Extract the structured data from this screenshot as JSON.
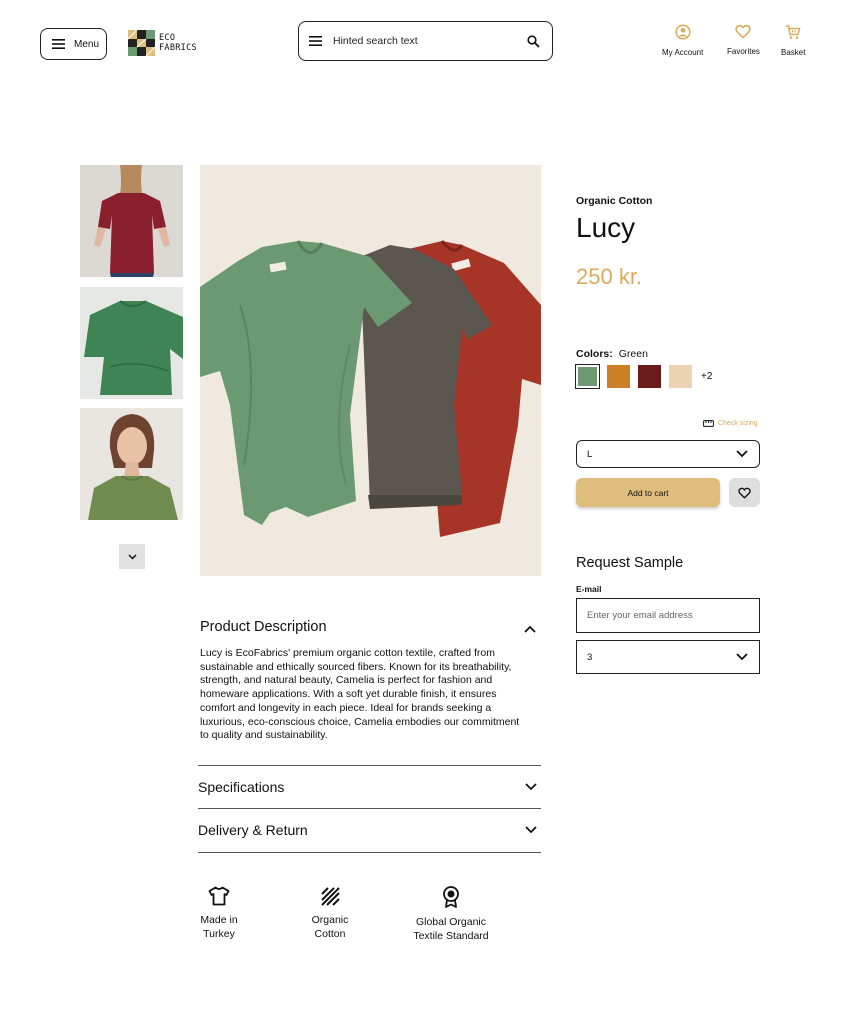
{
  "header": {
    "menu_label": "Menu",
    "logo_line1": "ECO",
    "logo_line2": "FABRICS",
    "search_placeholder": "Hinted search text",
    "account_label": "My Account",
    "favorites_label": "Favorites",
    "basket_label": "Basket"
  },
  "product": {
    "category": "Organic Cotton",
    "name": "Lucy",
    "price": "250 kr.",
    "colors_label": "Colors:",
    "selected_color": "Green",
    "swatches": [
      "#6b9a72",
      "#cc7f26",
      "#6b1c1a",
      "#ead2b2"
    ],
    "more_colors": "+2",
    "check_sizing": "Check sizing",
    "size": "L",
    "add_to_cart": "Add to cart"
  },
  "sample": {
    "title": "Request Sample",
    "email_label": "E-mail",
    "email_placeholder": "Enter your email address",
    "quantity": "3"
  },
  "description": {
    "title": "Product Description",
    "body": "Lucy is EcoFabrics' premium organic cotton textile, crafted from sustainable and ethically sourced fibers. Known for its breathability, strength, and natural beauty, Camelia is perfect for fashion and homeware applications. With a soft yet durable finish, it ensures comfort and longevity in each piece. Ideal for brands seeking a luxurious, eco-conscious choice, Camelia embodies our commitment to quality and sustainability."
  },
  "accordions": {
    "specifications": "Specifications",
    "delivery": "Delivery & Return"
  },
  "features": {
    "made_in": "Made in\nTurkey",
    "organic": "Organic\nCotton",
    "gots": "Global Organic\nTextile Standard"
  },
  "colors": {
    "accent": "#dcaa5b",
    "cart_button": "#dfbd7d"
  }
}
